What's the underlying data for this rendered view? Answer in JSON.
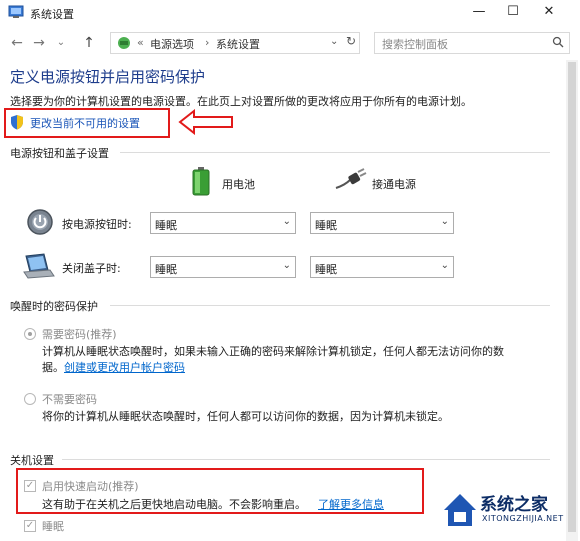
{
  "window": {
    "title": "系统设置",
    "minimize": "—",
    "maximize": "☐",
    "close": "✕"
  },
  "nav": {
    "back": "←",
    "forward": "→",
    "dropdown": "⌄",
    "up": "↑",
    "breadcrumb_sep0": "«",
    "breadcrumb": [
      "电源选项",
      "系统设置"
    ],
    "breadcrumb_sep": "›",
    "addr_dropdown": "⌄",
    "refresh": "↻",
    "search_placeholder": "搜索控制面板"
  },
  "page": {
    "heading": "定义电源按钮并启用密码保护",
    "description": "选择要为你的计算机设置的电源设置。在此页上对设置所做的更改将应用于你所有的电源计划。",
    "change_link": "更改当前不可用的设置"
  },
  "power_buttons": {
    "section_title": "电源按钮和盖子设置",
    "col_battery": "用电池",
    "col_plugged": "接通电源",
    "rows": [
      {
        "label": "按电源按钮时:",
        "battery": "睡眠",
        "plugged": "睡眠"
      },
      {
        "label": "关闭盖子时:",
        "battery": "睡眠",
        "plugged": "睡眠"
      }
    ]
  },
  "wake_password": {
    "section_title": "唤醒时的密码保护",
    "require_label": "需要密码(推荐)",
    "require_desc": "计算机从睡眠状态唤醒时，如果未输入正确的密码来解除计算机锁定，任何人都无法访问你的数",
    "require_desc2": "据。",
    "require_link": "创建或更改用户帐户密码",
    "no_require_label": "不需要密码",
    "no_require_desc": "将你的计算机从睡眠状态唤醒时，任何人都可以访问你的数据，因为计算机未锁定。"
  },
  "shutdown": {
    "section_title": "关机设置",
    "fast_startup_label": "启用快速启动(推荐)",
    "fast_startup_checked": true,
    "fast_startup_desc": "这有助于在关机之后更快地启动电脑。不会影响重启。",
    "learn_more": "了解更多信息",
    "sleep_label": "睡眠",
    "sleep_checked": true
  },
  "watermark": {
    "title": "系统之家",
    "url": "XITONGZHIJIA.NET"
  },
  "colors": {
    "heading": "#1e3d8c",
    "link": "#0066cc",
    "highlight": "#e21a1a"
  }
}
